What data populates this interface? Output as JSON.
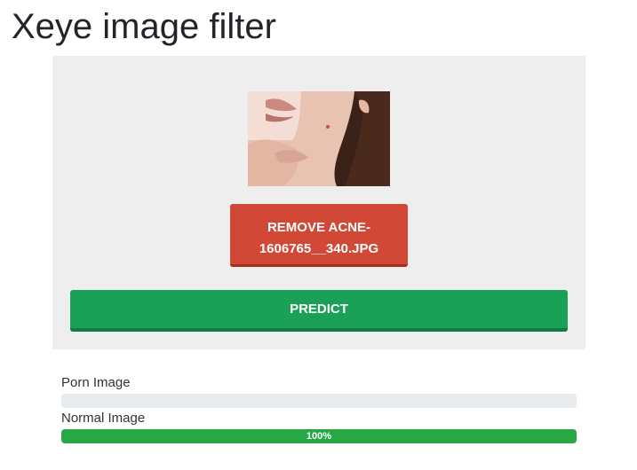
{
  "header": {
    "title": "Xeye image filter"
  },
  "upload": {
    "preview_alt": "Uploaded image preview",
    "file_button_label": "REMOVE ACNE-1606765__340.JPG",
    "predict_label": "PREDICT"
  },
  "results": [
    {
      "label": "Porn Image",
      "percent": 0,
      "percent_text": ""
    },
    {
      "label": "Normal Image",
      "percent": 100,
      "percent_text": "100%"
    }
  ],
  "colors": {
    "panel_bg": "#eeeeee",
    "file_button": "#d14836",
    "predict_button": "#1aa057",
    "progress_fill": "#28a745",
    "progress_track": "#e9ecef"
  }
}
